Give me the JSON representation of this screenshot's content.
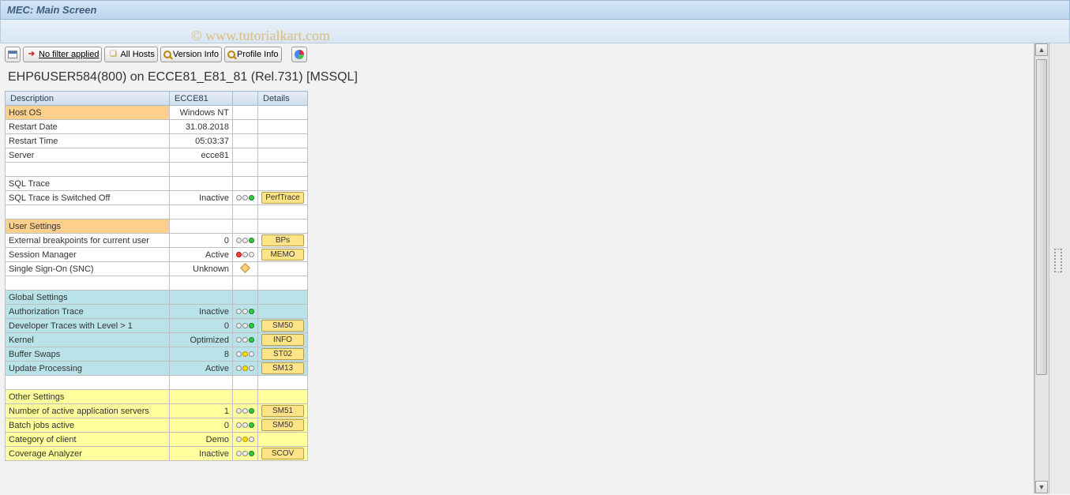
{
  "window": {
    "title": "MEC: Main Screen"
  },
  "watermark": "© www.tutorialkart.com",
  "toolbar": {
    "filter": "No filter applied",
    "hosts": "All Hosts",
    "version": "Version Info",
    "profile": "Profile Info"
  },
  "heading": "EHP6USER584(800) on ECCE81_E81_81 (Rel.731) [MSSQL]",
  "columns": {
    "desc": "Description",
    "val": "ECCE81",
    "det": "Details"
  },
  "rows": [
    {
      "type": "orange",
      "desc": "Host OS",
      "val": "Windows NT"
    },
    {
      "type": "data",
      "desc": "Restart Date",
      "val": "31.08.2018"
    },
    {
      "type": "data",
      "desc": "Restart Time",
      "val": "05:03:37"
    },
    {
      "type": "data",
      "desc": "Server",
      "val": "ecce81"
    },
    {
      "type": "blank"
    },
    {
      "type": "data",
      "desc": "SQL Trace"
    },
    {
      "type": "data",
      "desc": "SQL Trace is Switched Off",
      "val": "Inactive",
      "light": "green",
      "det": "PerfTrace"
    },
    {
      "type": "blank"
    },
    {
      "type": "orange",
      "desc": "User Settings"
    },
    {
      "type": "data",
      "desc": "External breakpoints for current user",
      "val": "0",
      "light": "green",
      "det": "BPs"
    },
    {
      "type": "data",
      "desc": "Session Manager",
      "val": "Active",
      "light": "red",
      "det": "MEMO"
    },
    {
      "type": "data",
      "desc": "Single Sign-On (SNC)",
      "val": "Unknown",
      "icon": "key"
    },
    {
      "type": "blank"
    },
    {
      "type": "cyan",
      "desc": "Global Settings"
    },
    {
      "type": "cyan",
      "desc": "Authorization Trace",
      "val": "Inactive",
      "light": "green"
    },
    {
      "type": "cyan",
      "desc": "Developer Traces with Level > 1",
      "val": "0",
      "light": "green",
      "det": "SM50"
    },
    {
      "type": "cyan",
      "desc": "Kernel",
      "val": "Optimized",
      "light": "green",
      "det": "INFO"
    },
    {
      "type": "cyan",
      "desc": "Buffer Swaps",
      "val": "8",
      "light": "yellow",
      "det": "ST02"
    },
    {
      "type": "cyan",
      "desc": "Update Processing",
      "val": "Active",
      "light": "yellow",
      "det": "SM13"
    },
    {
      "type": "blank"
    },
    {
      "type": "yellow",
      "desc": "Other Settings"
    },
    {
      "type": "yellow",
      "desc": "Number of active application servers",
      "val": "1",
      "light": "green",
      "det": "SM51"
    },
    {
      "type": "yellow",
      "desc": "Batch jobs active",
      "val": "0",
      "light": "green",
      "det": "SM50"
    },
    {
      "type": "yellow",
      "desc": "Category of client",
      "val": "Demo",
      "light": "yellow"
    },
    {
      "type": "yellow",
      "desc": "Coverage Analyzer",
      "val": "Inactive",
      "light": "green",
      "det": "SCOV"
    }
  ]
}
